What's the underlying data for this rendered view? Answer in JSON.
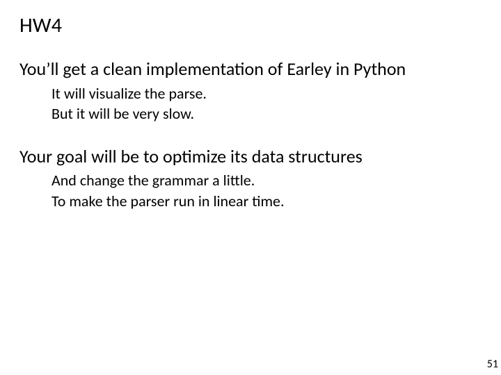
{
  "title": "HW4",
  "sections": [
    {
      "main": "You’ll get a clean implementation of Earley in Python",
      "subs": [
        "It will visualize the parse.",
        "But it will be very slow."
      ]
    },
    {
      "main": "Your goal will be to optimize its data structures",
      "subs": [
        "And change the grammar a little.",
        "To make the parser run in linear time."
      ]
    }
  ],
  "page_number": "51"
}
